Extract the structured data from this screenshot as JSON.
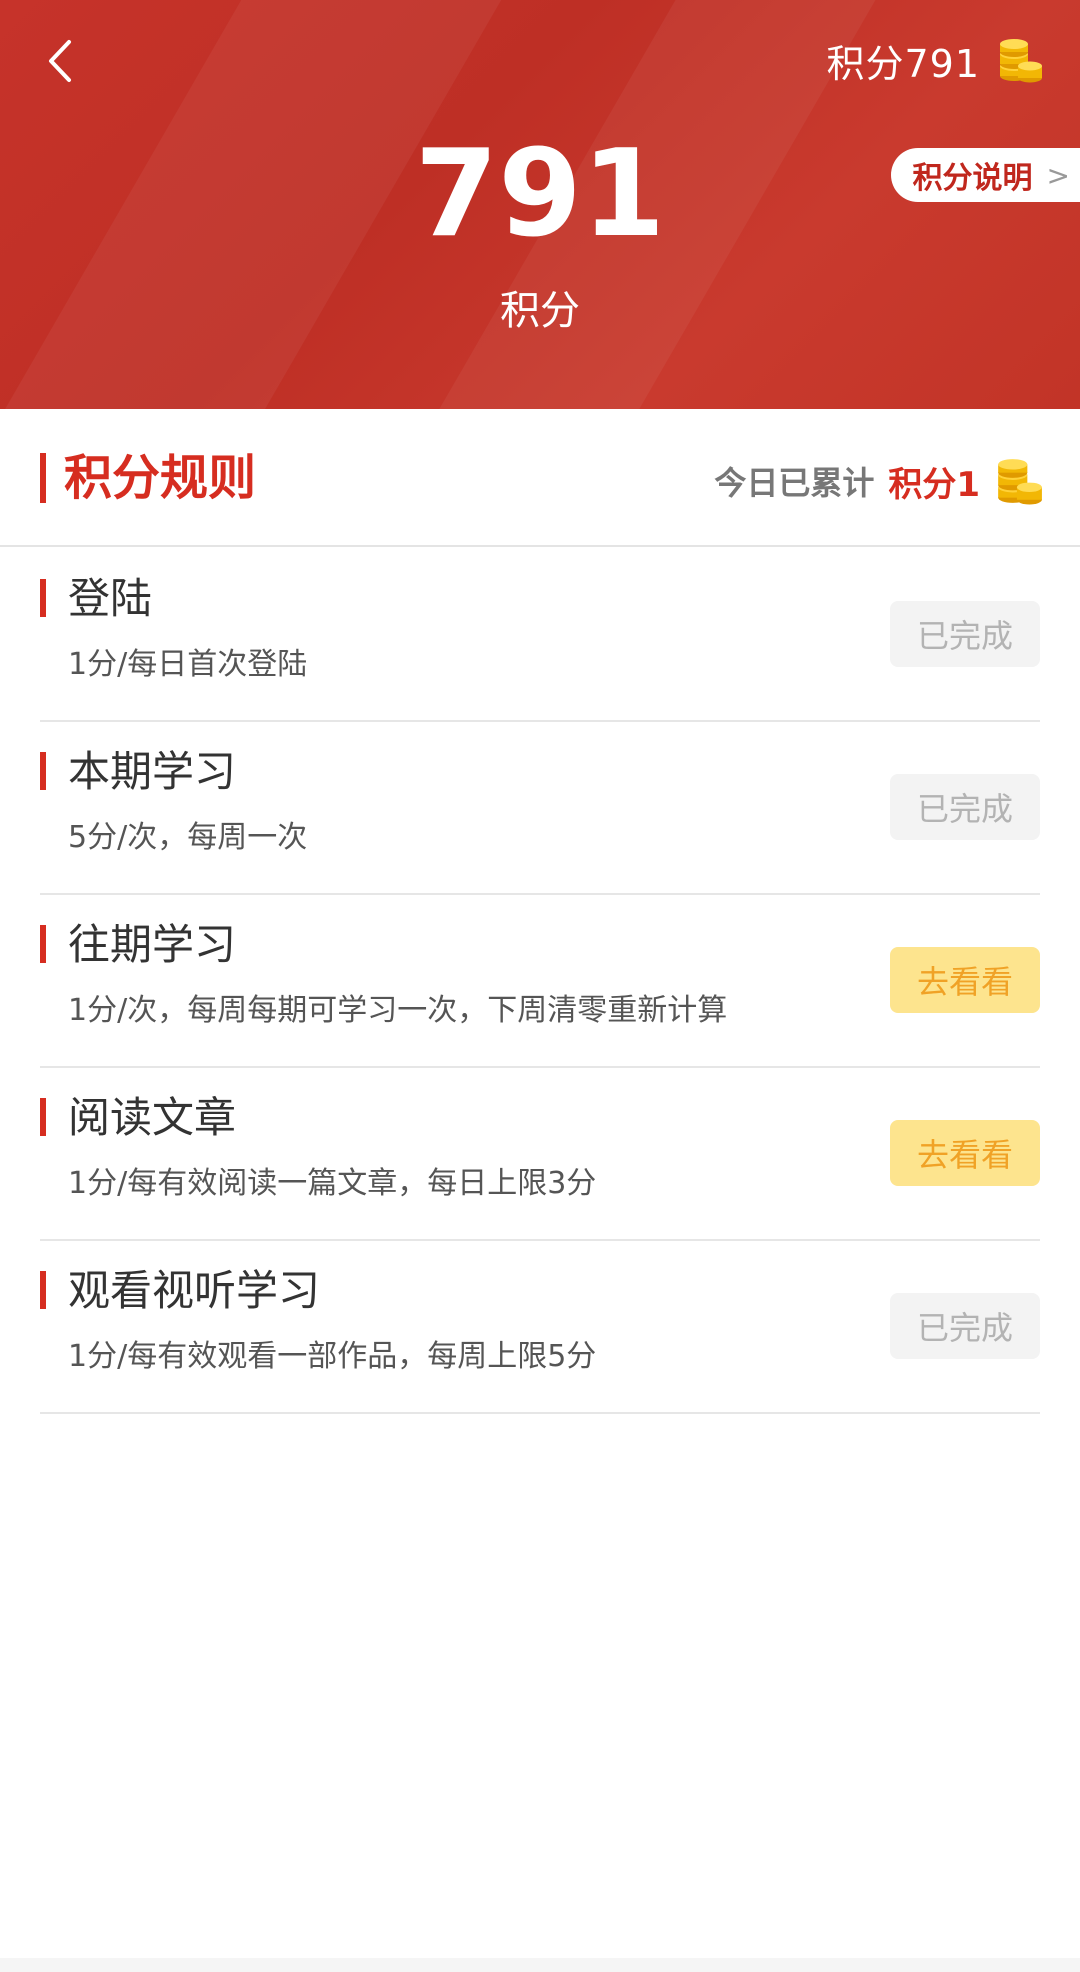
{
  "header": {
    "points_label": "积分791",
    "explain_label": "积分说明",
    "explain_arrow": ">",
    "points_value": "791",
    "points_unit": "积分"
  },
  "section": {
    "title": "积分规则",
    "today_label": "今日已累计",
    "today_value": "积分1"
  },
  "tasks": [
    {
      "name": "登陆",
      "desc": "1分/每日首次登陆",
      "action": "已完成",
      "status": "done"
    },
    {
      "name": "本期学习",
      "desc": "5分/次，每周一次",
      "action": "已完成",
      "status": "done"
    },
    {
      "name": "往期学习",
      "desc": "1分/次，每周每期可学习一次，下周清零重新计算",
      "action": "去看看",
      "status": "go"
    },
    {
      "name": "阅读文章",
      "desc": "1分/每有效阅读一篇文章，每日上限3分",
      "action": "去看看",
      "status": "go"
    },
    {
      "name": "观看视听学习",
      "desc": "1分/每有效观看一部作品，每周上限5分",
      "action": "已完成",
      "status": "done"
    }
  ],
  "icons": {
    "back": "back-arrow-icon",
    "coin": "coin-stack-icon"
  },
  "colors": {
    "header_red": "#c6332a",
    "accent_red": "#d62d20",
    "done_bg": "#f3f3f3",
    "done_text": "#b3b3b3",
    "go_bg": "#fde48e",
    "go_text": "#f0a226",
    "coin_gold": "#f2b705"
  }
}
